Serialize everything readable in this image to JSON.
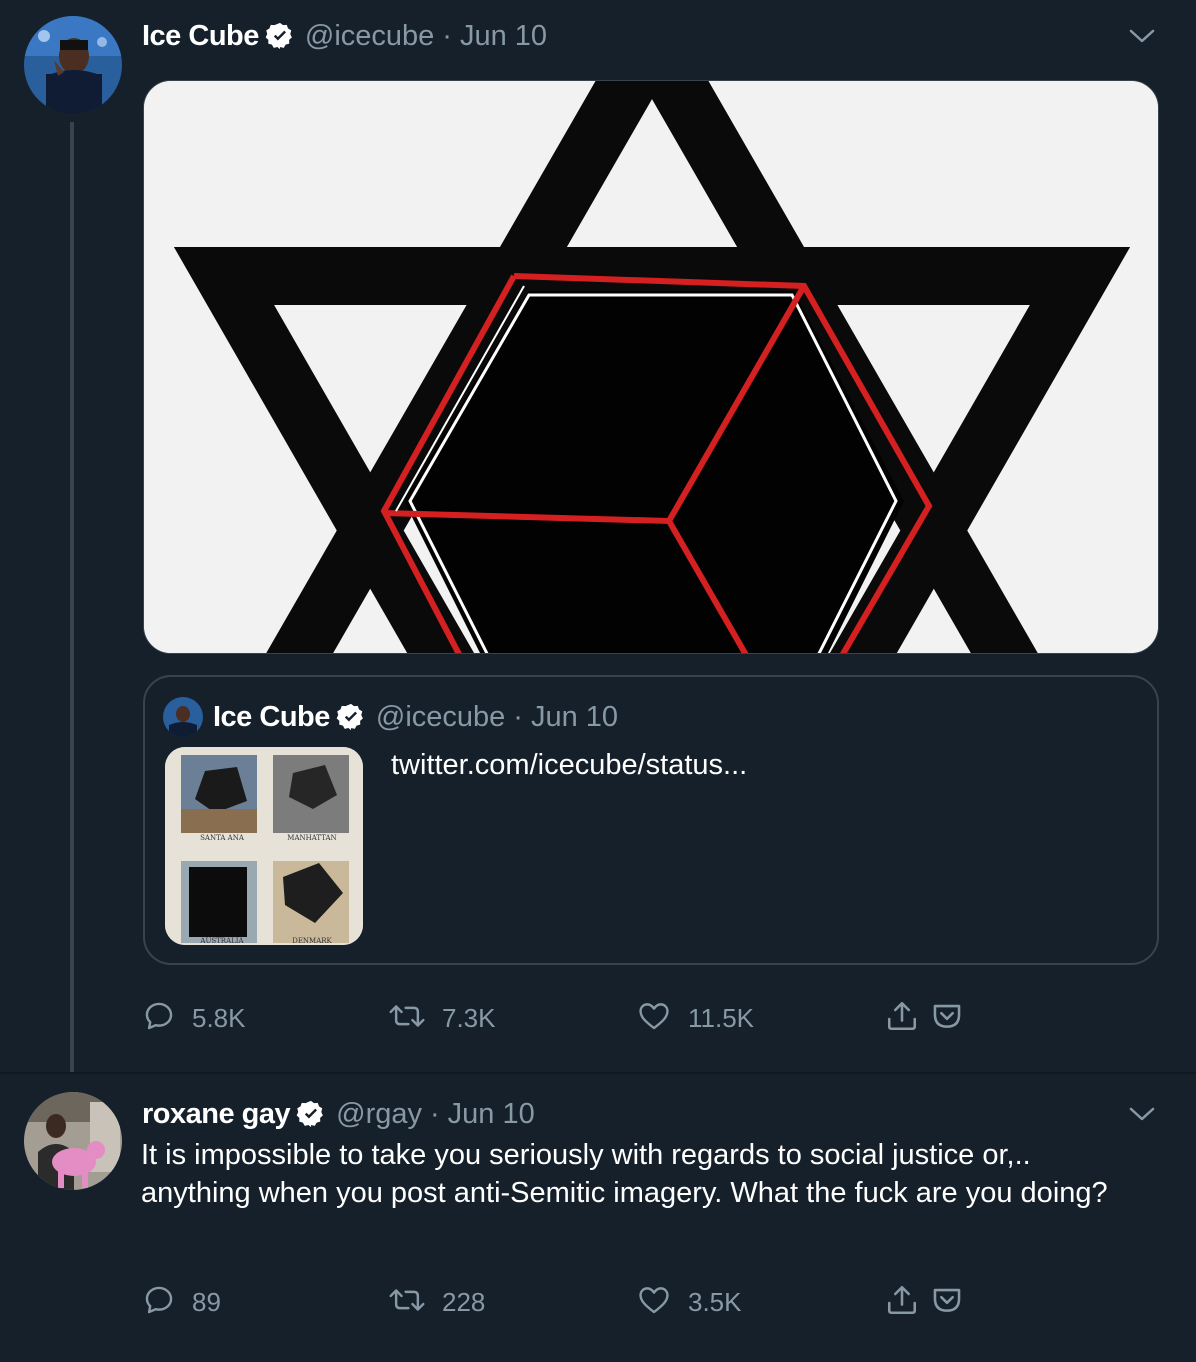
{
  "tweets": [
    {
      "name": "Ice Cube",
      "handle": "@icecube",
      "dot": "·",
      "date": "Jun 10",
      "quoted": {
        "name": "Ice Cube",
        "handle": "@icecube",
        "dot": "·",
        "date": "Jun 10",
        "link_text": "twitter.com/icecube/status...",
        "thumb_labels": [
          "SANTA ANA",
          "MANHATTAN",
          "AUSTRALIA",
          "DENMARK"
        ]
      },
      "stats": {
        "replies": "5.8K",
        "retweets": "7.3K",
        "likes": "11.5K"
      }
    },
    {
      "name": "roxane gay",
      "handle": "@rgay",
      "dot": "·",
      "date": "Jun 10",
      "text": "It is impossible to take you seriously with regards to social justice or,.. anything when you post anti-Semitic imagery. What the fuck are you doing?",
      "stats": {
        "replies": "89",
        "retweets": "228",
        "likes": "3.5K"
      }
    }
  ],
  "icons": [
    "verified-badge-icon",
    "chevron-down-icon",
    "reply-icon",
    "retweet-icon",
    "like-icon",
    "share-icon",
    "pocket-icon"
  ],
  "colors": {
    "background": "#15202b",
    "secondary_text": "#8899a6",
    "border": "#38444d",
    "verified": "#ffffff"
  }
}
